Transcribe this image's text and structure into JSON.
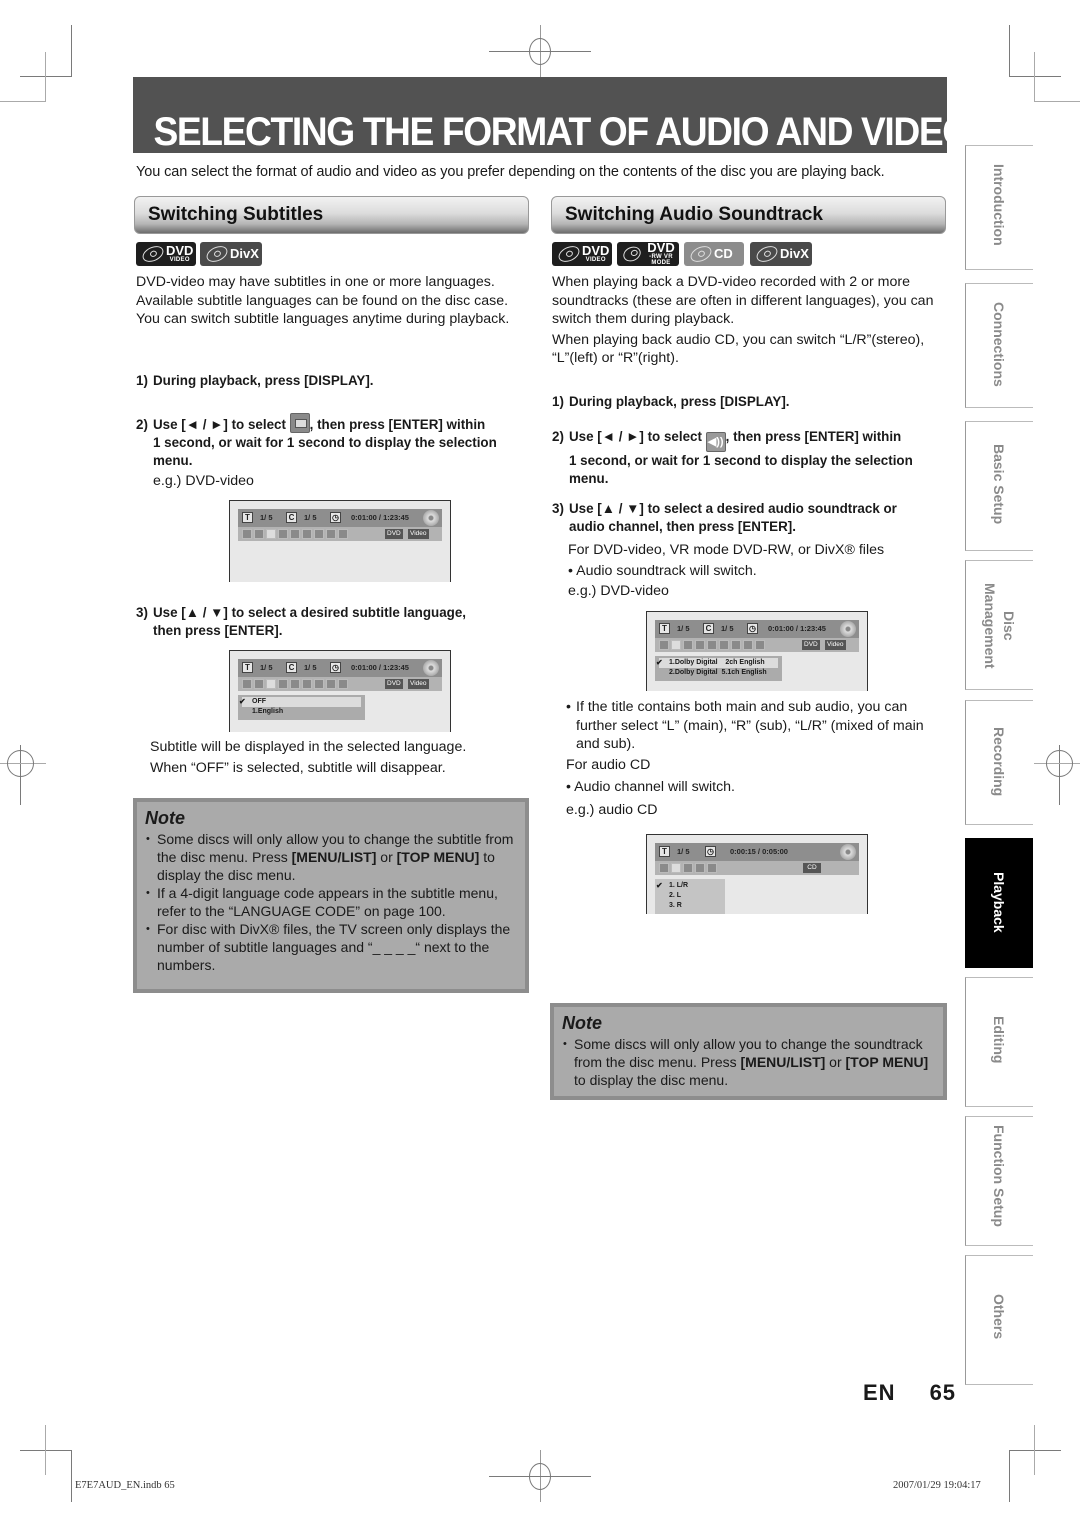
{
  "page": {
    "title": "SELECTING THE FORMAT OF AUDIO AND VIDEO",
    "intro": "You can select the format of audio and video as you prefer depending on the contents of the disc you are playing back.",
    "page_lang": "EN",
    "page_number": "65"
  },
  "subtitles": {
    "header": "Switching Subtitles",
    "badges": [
      {
        "icon": "dvd-video-disc-icon",
        "label": "DVD",
        "sub": "VIDEO"
      },
      {
        "icon": "divx-disc-icon",
        "label": "DivX",
        "sub": ""
      }
    ],
    "description": "DVD-video may have subtitles in one or more languages. Available subtitle languages can be found on the disc case. You can switch subtitle languages anytime during playback.",
    "step1": {
      "num": "1)",
      "text": "During playback, press [DISPLAY]."
    },
    "step2": {
      "num": "2)",
      "pre": "Use [◄ / ►] to select",
      "icon": "subtitle-icon",
      "post": ", then press [ENTER] within",
      "cont": "1 second, or wait for 1 second to display the selection menu."
    },
    "eg1": "e.g.) DVD-video",
    "step3": {
      "num": "3)",
      "text": "Use [▲ / ▼] to select a desired subtitle language,",
      "cont": "then press [ENTER]."
    },
    "result": [
      "Subtitle will be displayed in the selected language.",
      "When “OFF” is selected, subtitle will disappear."
    ],
    "note": {
      "title": "Note",
      "items": [
        {
          "pre": "Some discs will only allow you to change the subtitle from the disc menu. Press ",
          "b1": "[MENU/LIST]",
          "mid": " or ",
          "b2": "[TOP MENU]",
          "post": " to display the disc menu."
        },
        {
          "text": "If a 4-digit language code appears in the subtitle menu, refer to the “LANGUAGE CODE” on page 100."
        },
        {
          "text": "For disc with DivX® files, the TV screen only displays the number of subtitle languages and “_ _ _ _“ next to the numbers."
        }
      ]
    }
  },
  "audio": {
    "header": "Switching Audio Soundtrack",
    "badges": [
      {
        "icon": "dvd-video-disc-icon",
        "label": "DVD",
        "sub": "VIDEO"
      },
      {
        "icon": "dvd-rw-vr-disc-icon",
        "label": "DVD",
        "sub": "-RW VR MODE"
      },
      {
        "icon": "cd-disc-icon",
        "label": "CD",
        "sub": ""
      },
      {
        "icon": "divx-disc-icon",
        "label": "DivX",
        "sub": ""
      }
    ],
    "description1": "When playing back a DVD-video recorded with 2 or more soundtracks (these are often in different languages), you can switch them during playback.",
    "description2": "When playing back audio CD, you can switch “L/R”(stereo), “L”(left) or “R”(right).",
    "step1": {
      "num": "1)",
      "text": "During playback, press [DISPLAY]."
    },
    "step2": {
      "num": "2)",
      "pre": "Use [◄ / ►] to select",
      "icon": "audio-icon",
      "post": ", then press [ENTER] within",
      "cont": "1 second, or wait for 1 second to display the selection menu."
    },
    "step3": {
      "num": "3)",
      "text": "Use [▲ / ▼] to select a desired audio soundtrack or",
      "cont": "audio channel, then press [ENTER]."
    },
    "for_dvd": "For DVD-video, VR mode DVD-RW, or DivX® files",
    "bullet_switch": "• Audio soundtrack will switch.",
    "eg_dvd": "e.g.) DVD-video",
    "bullet_main_sub": "If the title contains both main and sub audio, you can further select “L” (main), “R” (sub), “L/R” (mixed of main and sub).",
    "for_cd": "For audio CD",
    "bullet_channel": "• Audio channel will switch.",
    "eg_cd": "e.g.) audio CD",
    "note": {
      "title": "Note",
      "items": [
        {
          "pre": "Some discs will only allow you to change the soundtrack from the disc menu. Press ",
          "b1": "[MENU/LIST]",
          "mid": " or ",
          "b2": "[TOP MENU]",
          "post": " to display the disc menu."
        }
      ]
    }
  },
  "screens": {
    "dvd": {
      "title_box": "T",
      "title_val": "1/  5",
      "chapter_box": "C",
      "chapter_val": "1/  5",
      "time": "0:01:00 / 1:23:45",
      "tag1": "DVD",
      "tag2": "Video"
    },
    "subtitle_menu": [
      {
        "label": "OFF",
        "selected": true
      },
      {
        "label": "1.English",
        "selected": false
      }
    ],
    "audio_menu": [
      {
        "label": "1.Dolby Digital    2ch English",
        "selected": true
      },
      {
        "label": "2.Dolby Digital  5.1ch English",
        "selected": false
      }
    ],
    "cd": {
      "title_box": "T",
      "title_val": "1/  5",
      "time": "0:00:15 / 0:05:00",
      "tag": "CD"
    },
    "cd_menu": [
      {
        "label": "1. L/R",
        "selected": true
      },
      {
        "label": "2. L",
        "selected": false
      },
      {
        "label": "3. R",
        "selected": false
      }
    ]
  },
  "side_tabs": [
    {
      "label": "Introduction",
      "active": false
    },
    {
      "label": "Connections",
      "active": false
    },
    {
      "label": "Basic Setup",
      "active": false
    },
    {
      "label": "Disc Management",
      "active": false
    },
    {
      "label": "Recording",
      "active": false
    },
    {
      "label": "Playback",
      "active": true
    },
    {
      "label": "Editing",
      "active": false
    },
    {
      "label": "Function Setup",
      "active": false
    },
    {
      "label": "Others",
      "active": false
    }
  ],
  "footer": {
    "file": "E7E7AUD_EN.indb  65",
    "datetime": "2007/01/29   19:04:17"
  }
}
